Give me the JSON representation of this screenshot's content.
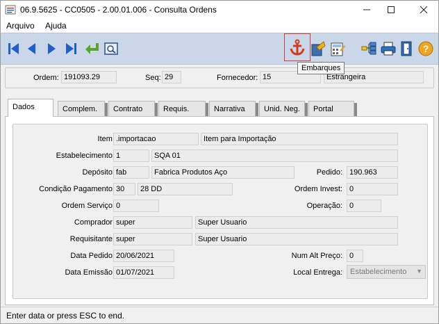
{
  "window": {
    "title": "06.9.5625 - CC0505 - 2.00.01.006 - Consulta Ordens"
  },
  "menu": {
    "items": [
      {
        "label": "Arquivo"
      },
      {
        "label": "Ajuda"
      }
    ]
  },
  "toolbar": {
    "tooltip": "Embarques"
  },
  "header": {
    "ordem_label": "Ordem:",
    "ordem_value": "191093.29",
    "seq_label": "Seq:",
    "seq_value": "29",
    "fornecedor_label": "Fornecedor:",
    "fornecedor_value": "15",
    "fornecedor_name": "Estrangeira"
  },
  "tabs": [
    {
      "label": "Dados"
    },
    {
      "label": "Complem."
    },
    {
      "label": "Contrato"
    },
    {
      "label": "Requis."
    },
    {
      "label": "Narrativa"
    },
    {
      "label": "Unid. Neg."
    },
    {
      "label": "Portal"
    }
  ],
  "form": {
    "item_label": "Item:",
    "item_code": ".importacao",
    "item_desc": "Item para Importação",
    "estab_label": "Estabelecimento:",
    "estab_code": "1",
    "estab_desc": "SQA 01",
    "deposito_label": "Depósito:",
    "deposito_code": "fab",
    "deposito_desc": "Fabrica Produtos Aço",
    "pedido_label": "Pedido:",
    "pedido_value": "190.963",
    "cond_label": "Condição Pagamento:",
    "cond_code": "30",
    "cond_desc": "28 DD",
    "invest_label": "Ordem Invest:",
    "invest_value": "0",
    "servico_label": "Ordem Serviço:",
    "servico_value": "0",
    "operacao_label": "Operação:",
    "operacao_value": "0",
    "comprador_label": "Comprador:",
    "comprador_code": "super",
    "comprador_name": "Super Usuario",
    "requis_label": "Requisitante:",
    "requis_code": "super",
    "requis_name": "Super Usuario",
    "data_pedido_label": "Data Pedido:",
    "data_pedido_value": "20/06/2021",
    "num_alt_label": "Num Alt Preço:",
    "num_alt_value": "0",
    "data_emissao_label": "Data Emissão:",
    "data_emissao_value": "01/07/2021",
    "local_entrega_label": "Local Entrega:",
    "local_entrega_value": "Estabelecimento"
  },
  "status": {
    "text": "Enter data or press ESC to end."
  },
  "icons": {
    "first": "first-record-icon",
    "prev": "previous-record-icon",
    "next": "next-record-icon",
    "last": "last-record-icon",
    "goto": "goto-icon",
    "search": "search-icon",
    "anchor": "anchor-icon",
    "export": "export-icon",
    "calc": "calculator-icon",
    "tree": "tree-icon",
    "print": "print-icon",
    "exit": "exit-icon",
    "help": "help-icon"
  }
}
